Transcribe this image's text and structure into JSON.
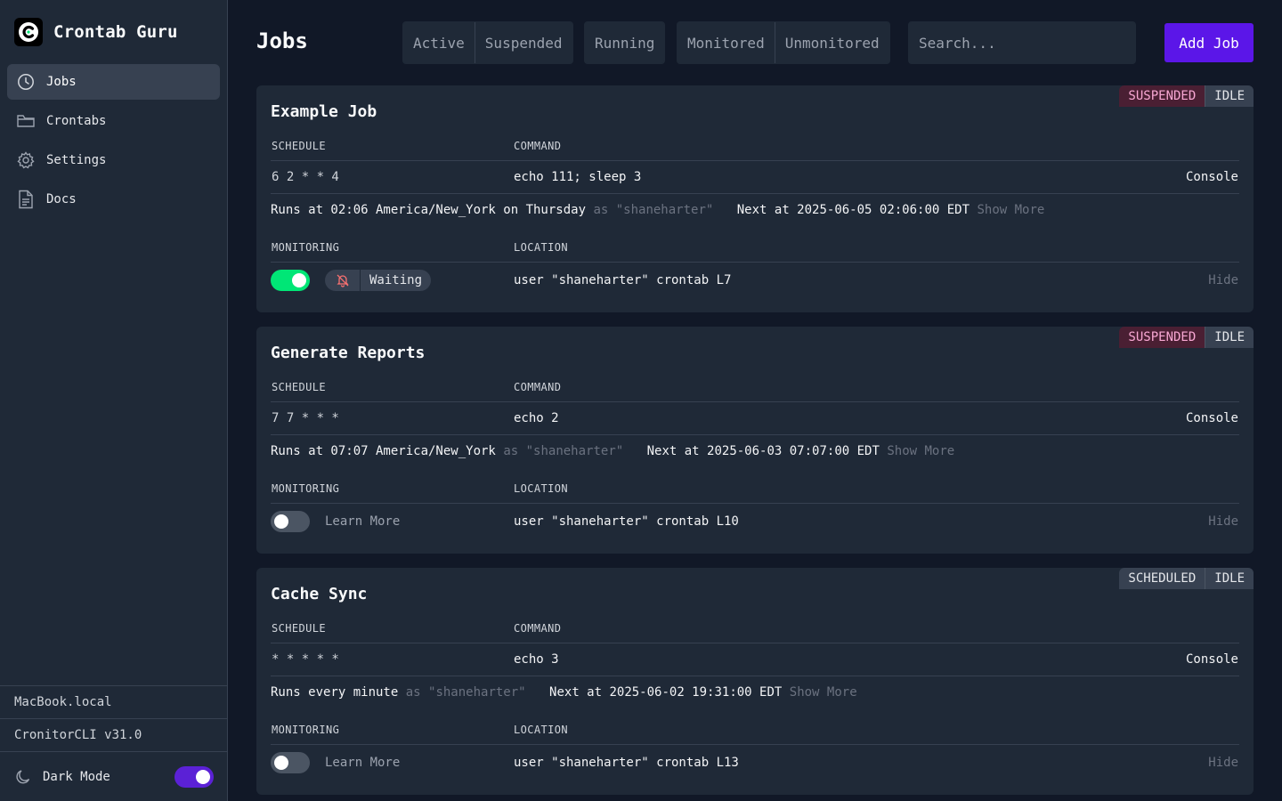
{
  "app": {
    "name": "Crontab Guru"
  },
  "sidebar": {
    "items": [
      {
        "label": "Jobs",
        "icon": "clock-icon",
        "active": true
      },
      {
        "label": "Crontabs",
        "icon": "folder-icon",
        "active": false
      },
      {
        "label": "Settings",
        "icon": "gear-icon",
        "active": false
      },
      {
        "label": "Docs",
        "icon": "document-icon",
        "active": false
      }
    ],
    "host": "MacBook.local",
    "version": "CronitorCLI v31.0",
    "dark_mode_label": "Dark Mode",
    "dark_mode_on": true
  },
  "header": {
    "title": "Jobs",
    "filters_status": [
      "Active",
      "Suspended"
    ],
    "filters_running": [
      "Running"
    ],
    "filters_monitor": [
      "Monitored",
      "Unmonitored"
    ],
    "search_placeholder": "Search...",
    "add_label": "Add Job"
  },
  "labels": {
    "schedule": "SCHEDULE",
    "command": "COMMAND",
    "monitoring": "MONITORING",
    "location": "LOCATION",
    "console": "Console",
    "hide": "Hide",
    "show_more": "Show More",
    "learn_more": "Learn More"
  },
  "jobs": [
    {
      "title": "Example Job",
      "status": "SUSPENDED",
      "state": "IDLE",
      "schedule": "6 2 * * 4",
      "command": "echo 111; sleep 3",
      "runs": "Runs at 02:06 America/New_York on Thursday",
      "as_user": "as \"shaneharter\"",
      "next": "Next at 2025-06-05 02:06:00 EDT",
      "monitoring_on": true,
      "monitor_status": "Waiting",
      "location": "user \"shaneharter\" crontab L7"
    },
    {
      "title": "Generate Reports",
      "status": "SUSPENDED",
      "state": "IDLE",
      "schedule": "7 7 * * *",
      "command": "echo 2",
      "runs": "Runs at 07:07 America/New_York",
      "as_user": "as \"shaneharter\"",
      "next": "Next at 2025-06-03 07:07:00 EDT",
      "monitoring_on": false,
      "location": "user \"shaneharter\" crontab L10"
    },
    {
      "title": "Cache Sync",
      "status": "SCHEDULED",
      "state": "IDLE",
      "schedule": "* * * * *",
      "command": "echo 3",
      "runs": "Runs every minute",
      "as_user": "as \"shaneharter\"",
      "next": "Next at 2025-06-02 19:31:00 EDT",
      "monitoring_on": false,
      "location": "user \"shaneharter\" crontab L13"
    }
  ],
  "colors": {
    "accent": "#5b16e8",
    "toggle_on": "#00e676",
    "suspended_badge": "#f9a8d4"
  }
}
